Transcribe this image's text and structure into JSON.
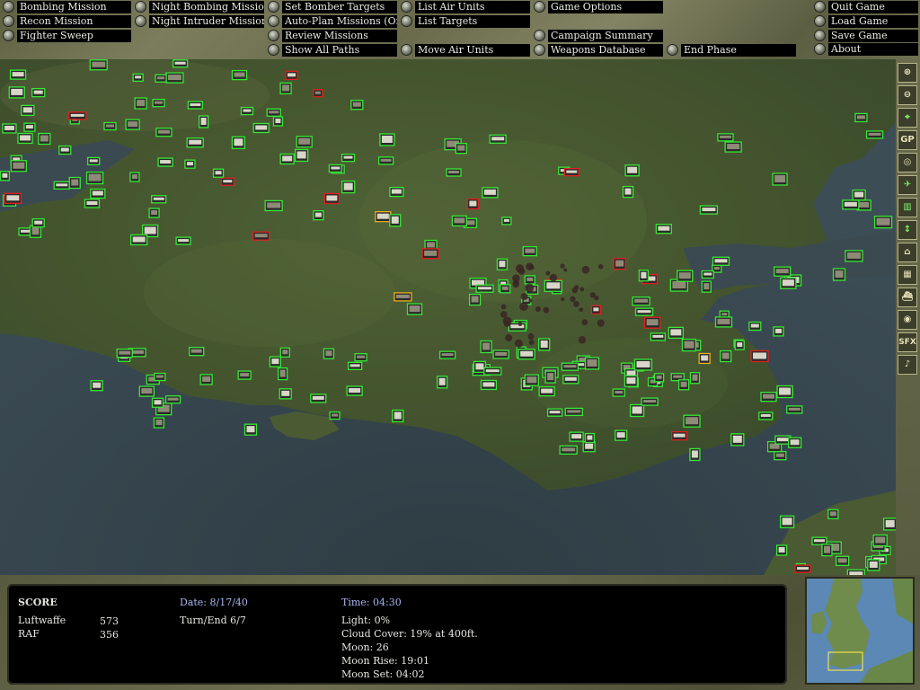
{
  "menu": {
    "bombing_mission": "Bombing Mission",
    "recon_mission": "Recon Mission",
    "fighter_sweep": "Fighter Sweep",
    "night_bombing": "Night Bombing Mission",
    "night_intruder": "Night Intruder Mission",
    "set_bomber_targets": "Set Bomber Targets",
    "auto_plan": "Auto-Plan Missions (Off)",
    "review_missions": "Review Missions",
    "show_all_paths": "Show All Paths",
    "list_air_units": "List Air Units",
    "list_targets": "List Targets",
    "move_air_units": "Move Air Units",
    "game_options": "Game Options",
    "campaign_summary": "Campaign Summary",
    "weapons_database": "Weapons Database",
    "end_phase": "End Phase",
    "quit_game": "Quit Game",
    "load_game": "Load Game",
    "save_game": "Save Game",
    "about": "About"
  },
  "toolbar": {
    "zoom_in": "⊕",
    "zoom_out": "⊖",
    "target": "⌖",
    "gp": "GP",
    "compass": "◎",
    "plane": "✈",
    "bars": "▥",
    "arrow": "↕",
    "airfield": "⌂",
    "building": "▦",
    "ship": "⛴",
    "clock": "◉",
    "sfx": "SFX",
    "music": "♪"
  },
  "status": {
    "score_title": "SCORE",
    "luftwaffe_label": "Luftwaffe",
    "luftwaffe_score": "573",
    "raf_label": "RAF",
    "raf_score": "356",
    "date": "Date: 8/17/40",
    "turn": "Turn/End 6/7",
    "time": "Time: 04:30",
    "light": "Light: 0%",
    "cloud": "Cloud Cover: 19% at 400ft.",
    "moon": "Moon: 26",
    "moon_rise": "Moon Rise: 19:01",
    "moon_set": "Moon Set: 04:02"
  },
  "colors": {
    "unit_green": "#39e639",
    "unit_red": "#e02020",
    "unit_yellow": "#e8b020",
    "sea": "#3a4a52",
    "land": "#4a5a30"
  }
}
